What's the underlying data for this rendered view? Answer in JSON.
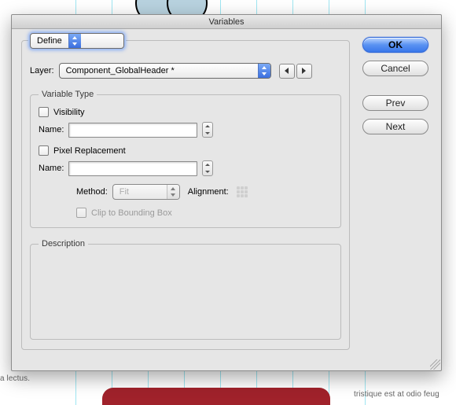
{
  "dialog": {
    "title": "Variables",
    "define_label": "Define",
    "layer_label": "Layer:",
    "layer_value": "Component_GlobalHeader *",
    "variable_type": {
      "legend": "Variable Type",
      "visibility_label": "Visibility",
      "pixel_replacement_label": "Pixel Replacement",
      "name_label": "Name:",
      "name_value_1": "",
      "name_value_2": "",
      "method_label": "Method:",
      "method_value": "Fit",
      "alignment_label": "Alignment:",
      "clip_label": "Clip to Bounding Box"
    },
    "description_legend": "Description",
    "buttons": {
      "ok": "OK",
      "cancel": "Cancel",
      "prev": "Prev",
      "next": "Next"
    }
  },
  "background": {
    "footer_text": "tristique est at odio feug",
    "lectus_text": "a lectus."
  }
}
